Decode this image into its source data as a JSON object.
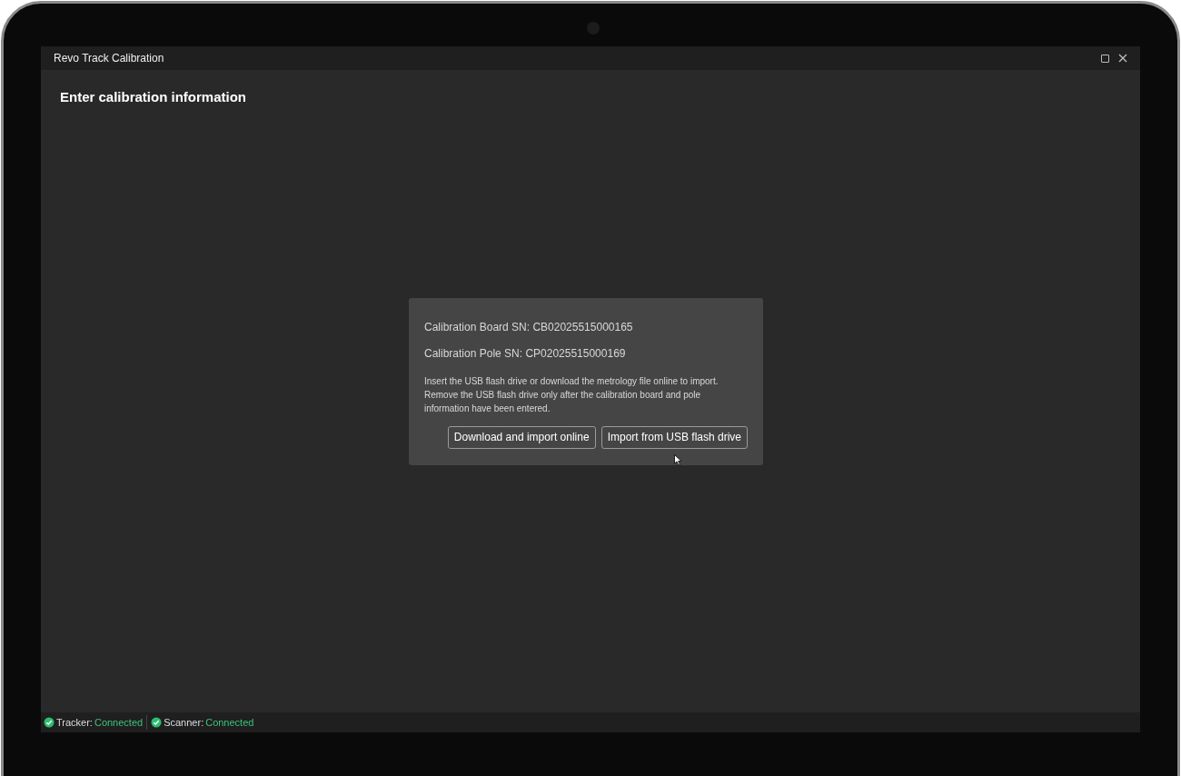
{
  "window": {
    "title": "Revo Track Calibration"
  },
  "heading": "Enter calibration information",
  "dialog": {
    "fields": [
      "Calibration Board SN: CB02025515000165",
      "Calibration Pole SN: CP02025515000169"
    ],
    "message": "Insert the USB flash drive or download the metrology file online to import. Remove the USB flash drive only after the calibration board and pole information have been entered.",
    "buttons": [
      "Download and import online",
      "Import from USB flash drive"
    ]
  },
  "status_bar": [
    {
      "label": "Tracker:",
      "value": "Connected",
      "connected": true
    },
    {
      "label": "Scanner:",
      "value": "Connected",
      "connected": true
    }
  ]
}
